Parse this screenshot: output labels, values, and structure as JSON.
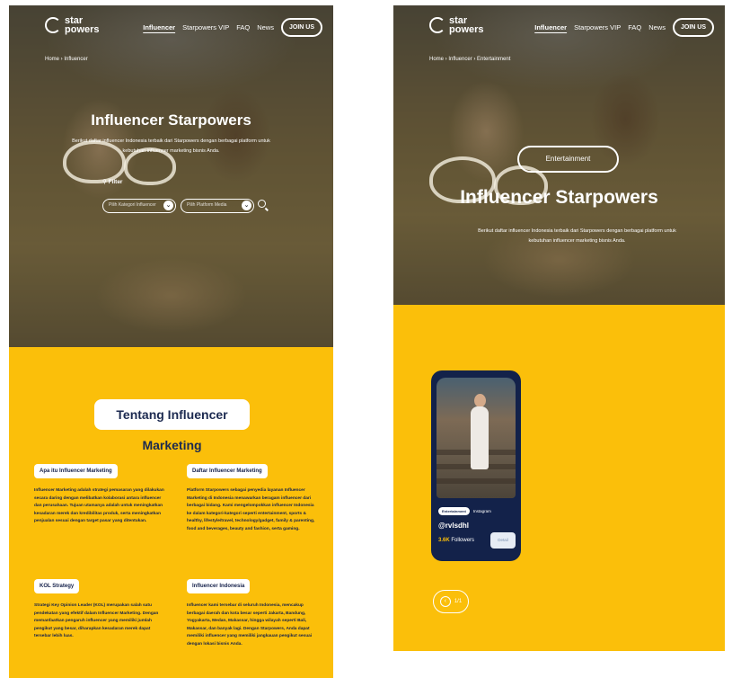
{
  "brand": {
    "logo_text": "star powers"
  },
  "nav": {
    "items": [
      "Influencer",
      "Starpowers VIP",
      "FAQ",
      "News"
    ],
    "join": "JOIN US"
  },
  "left": {
    "breadcrumb": "Home › Influencer",
    "title": "Influencer Starpowers",
    "description": "Berikut daftar influencer Indonesia terbaik dari Starpowers dengan berbagai platform untuk kebutuhan influencer marketing bisnis Anda.",
    "filter_label": "⚲ Filter",
    "select1": "Pilih Kategori Influencer",
    "select2": "Pilih Platform Media",
    "section_title": "Tentang Influencer Marketing",
    "cards": [
      {
        "title": "Apa itu Influencer Marketing",
        "text": "Influencer Marketing adalah strategi pemasaran yang dilakukan secara daring dengan melibatkan kolaborasi antara influencer dan perusahaan. Tujuan utamanya adalah untuk meningkatkan kesadaran merek dan kredibilitas produk, serta meningkatkan penjualan sesuai dengan target pasar yang ditentukan."
      },
      {
        "title": "Daftar Influencer Marketing",
        "text": "Platform Starpowers sebagai penyedia layanan Influencer Marketing di Indonesia menawarkan beragam influencer dari berbagai bidang. Kami mengelompokkan influencer Indonesia ke dalam kategori-kategori seperti entertainment, sports & healthy, lifestyle/travel, technology/gadget, family & parenting, food and beverages, beauty and fashion, serta gaming."
      },
      {
        "title": "KOL Strategy",
        "text": "Strategi Key Opinion Leader (KOL) merupakan salah satu pendekatan yang efektif dalam Influencer Marketing. Dengan memanfaatkan pengaruh influencer yang memiliki jumlah pengikut yang besar, diharapkan kesadaran merek dapat tersebar lebih luas."
      },
      {
        "title": "Influencer Indonesia",
        "text": "Influencer kami tersebar di seluruh Indonesia, mencakup berbagai daerah dan kota besar seperti Jakarta, Bandung, Yogyakarta, Medan, Makassar, hingga wilayah seperti Bali, Makassar, dan banyak lagi. Dengan Starpowers, Anda dapat memiliki influencer yang memiliki jangkauan pengikut sesuai dengan lokasi bisnis Anda."
      }
    ]
  },
  "right": {
    "breadcrumb": "Home › Influencer › Entertainment",
    "category_pill": "Entertainment",
    "title": "Influencer Starpowers",
    "description": "Berikut daftar influencer Indonesia terbaik dari Starpowers dengan berbagai platform untuk kebutuhan influencer marketing bisnis Anda.",
    "card": {
      "tag": "Entertainment",
      "platform": "Instagram",
      "handle": "@rvlsdhl",
      "followers_count": "3.6K",
      "followers_label": "Followers",
      "button": "Detail"
    },
    "pager": {
      "arrow": "‹",
      "text": "1/1"
    }
  }
}
